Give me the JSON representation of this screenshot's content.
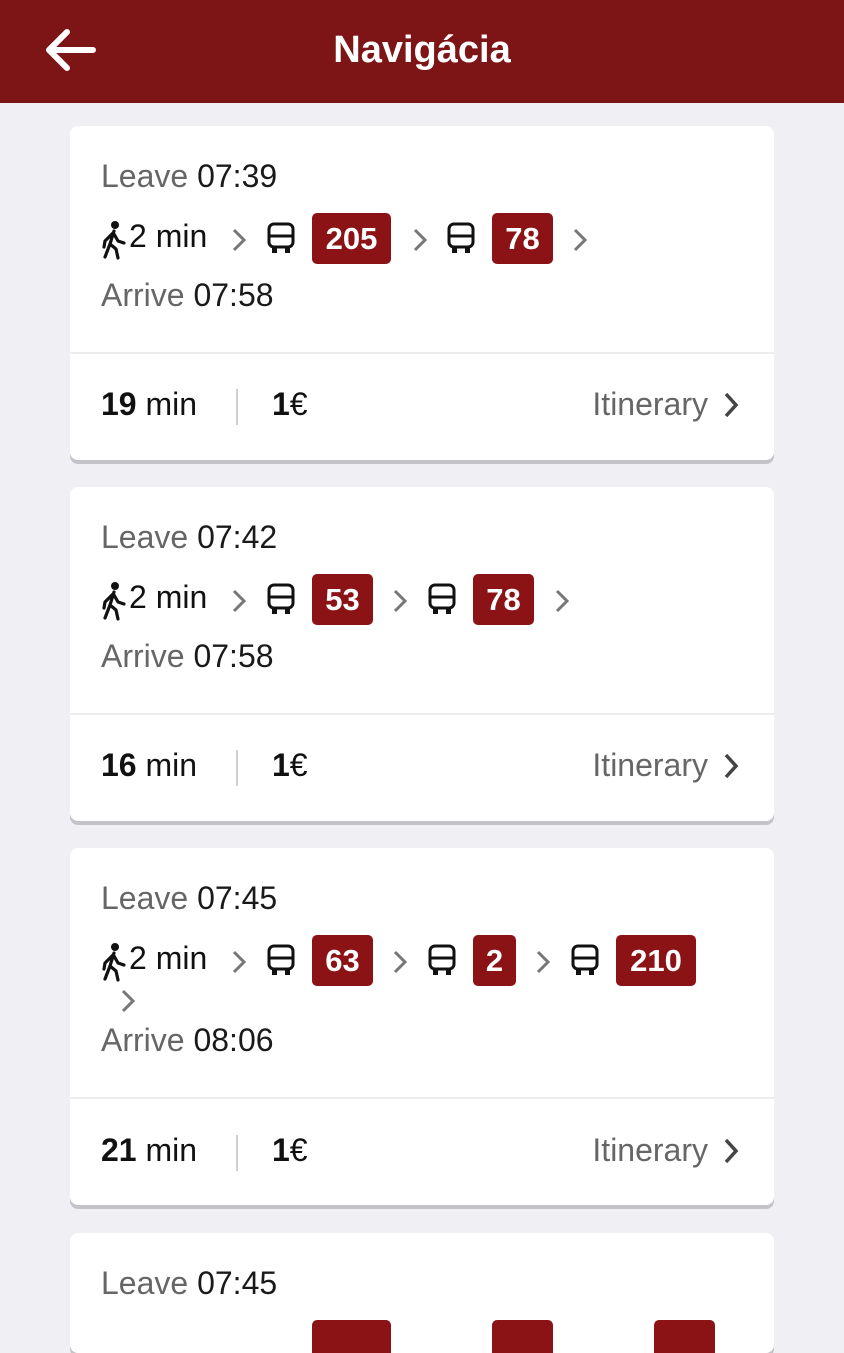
{
  "header": {
    "title": "Navigácia",
    "back_icon": "arrow-left-icon"
  },
  "colors": {
    "header": "#7d1517",
    "badge": "#8b1316",
    "background": "#efeff4"
  },
  "routes": [
    {
      "leave_label": "Leave",
      "leave_time": "07:39",
      "walk": "2 min",
      "buses": [
        "205",
        "78"
      ],
      "arrive_label": "Arrive",
      "arrive_time": "07:58",
      "duration_value": "19",
      "duration_unit": "min",
      "price_value": "1",
      "price_currency": "€",
      "itinerary_label": "Itinerary"
    },
    {
      "leave_label": "Leave",
      "leave_time": "07:42",
      "walk": "2 min",
      "buses": [
        "53",
        "78"
      ],
      "arrive_label": "Arrive",
      "arrive_time": "07:58",
      "duration_value": "16",
      "duration_unit": "min",
      "price_value": "1",
      "price_currency": "€",
      "itinerary_label": "Itinerary"
    },
    {
      "leave_label": "Leave",
      "leave_time": "07:45",
      "walk": "2 min",
      "buses": [
        "63",
        "2",
        "210"
      ],
      "arrive_label": "Arrive",
      "arrive_time": "08:06",
      "duration_value": "21",
      "duration_unit": "min",
      "price_value": "1",
      "price_currency": "€",
      "itinerary_label": "Itinerary"
    },
    {
      "leave_label": "Leave",
      "leave_time": "07:45"
    }
  ]
}
